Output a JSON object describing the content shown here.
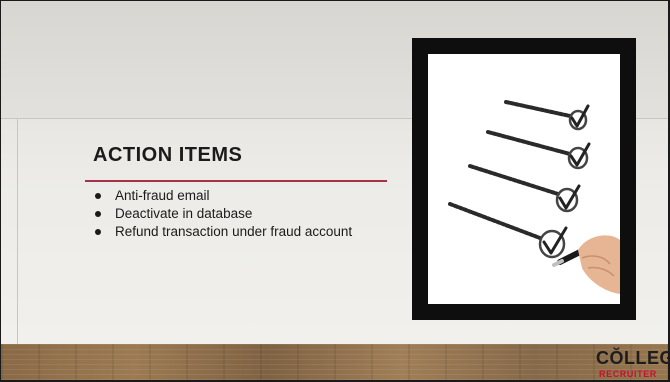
{
  "slide": {
    "title": "ACTION ITEMS",
    "items": [
      "Anti-fraud email",
      "Deactivate in database",
      "Refund transaction under fraud account"
    ]
  },
  "image": {
    "description_icon": "checklist-image"
  },
  "logo": {
    "line1": "CŎLLEGE",
    "line2": "RECRUITER"
  },
  "colors": {
    "accent_rule": "#a8324a",
    "logo_red": "#c8102e"
  }
}
